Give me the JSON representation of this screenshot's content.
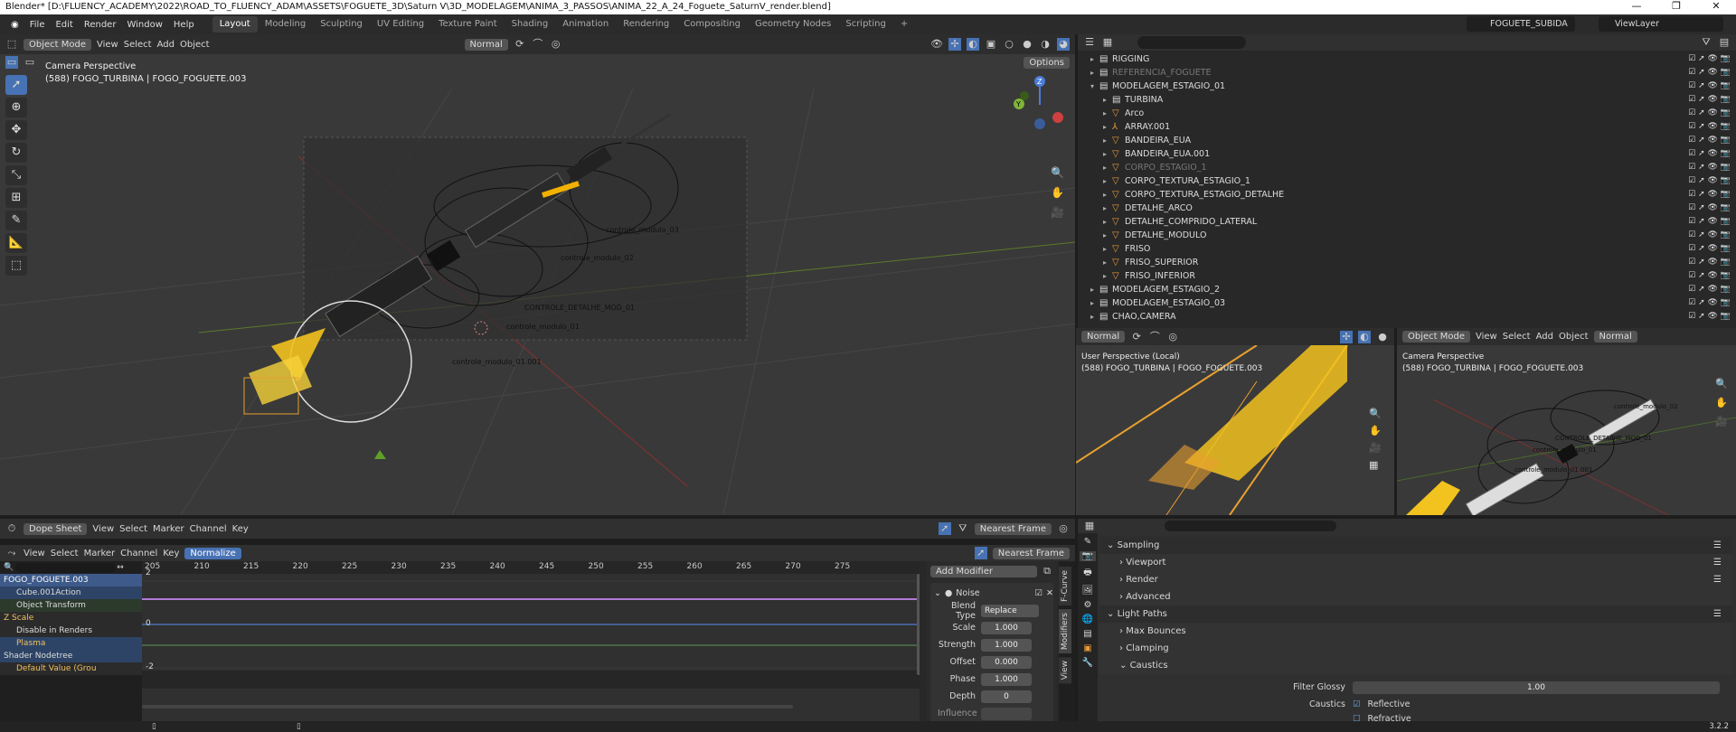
{
  "window": {
    "title": "Blender* [D:\\FLUENCY_ACADEMY\\2022\\ROAD_TO_FLUENCY_ADAM\\ASSETS\\FOGUETE_3D\\Saturn V\\3D_MODELAGEM\\ANIMA_3_PASSOS\\ANIMA_22_A_24_Foguete_SaturnV_render.blend]",
    "minimize": "—",
    "maximize": "❐",
    "close": "✕"
  },
  "menu": [
    "File",
    "Edit",
    "Render",
    "Window",
    "Help"
  ],
  "workspaces": [
    "Layout",
    "Modeling",
    "Sculpting",
    "UV Editing",
    "Texture Paint",
    "Shading",
    "Animation",
    "Rendering",
    "Compositing",
    "Geometry Nodes",
    "Scripting",
    "+"
  ],
  "scene": {
    "name": "FOGUETE_SUBIDA",
    "view_layer": "ViewLayer"
  },
  "viewport": {
    "mode": "Object Mode",
    "menus": [
      "View",
      "Select",
      "Add",
      "Object"
    ],
    "orientation": "Normal",
    "options": "Options",
    "label1": "Camera Perspective",
    "label2": "(588) FOGO_TURBINA | FOGO_FOGUETE.003",
    "scene_labels": [
      "controle_modulo_03",
      "controle_modulo_02",
      "CONTROLE_DETALHE_MOD_01",
      "controle_modulo_01",
      "controle_modulo_01.001"
    ]
  },
  "outliner": {
    "rows": [
      {
        "name": "RIGGING",
        "indent": 1,
        "icon": "▤",
        "color": "#ddd"
      },
      {
        "name": "REFERENCIA_FOGUETE",
        "indent": 1,
        "icon": "▤",
        "color": "#777"
      },
      {
        "name": "MODELAGEM_ESTAGIO_01",
        "indent": 1,
        "icon": "▤",
        "color": "#ddd",
        "open": true
      },
      {
        "name": "TURBINA",
        "indent": 2,
        "icon": "▤",
        "color": "#ddd"
      },
      {
        "name": "Arco",
        "indent": 2,
        "icon": "▽",
        "color": "#ddd"
      },
      {
        "name": "ARRAY.001",
        "indent": 2,
        "icon": "⅄",
        "color": "#ddd"
      },
      {
        "name": "BANDEIRA_EUA",
        "indent": 2,
        "icon": "▽",
        "color": "#ddd"
      },
      {
        "name": "BANDEIRA_EUA.001",
        "indent": 2,
        "icon": "▽",
        "color": "#ddd"
      },
      {
        "name": "CORPO_ESTAGIO_1",
        "indent": 2,
        "icon": "▽",
        "color": "#777"
      },
      {
        "name": "CORPO_TEXTURA_ESTAGIO_1",
        "indent": 2,
        "icon": "▽",
        "color": "#ddd"
      },
      {
        "name": "CORPO_TEXTURA_ESTAGIO_DETALHE",
        "indent": 2,
        "icon": "▽",
        "color": "#ddd"
      },
      {
        "name": "DETALHE_ARCO",
        "indent": 2,
        "icon": "▽",
        "color": "#ddd"
      },
      {
        "name": "DETALHE_COMPRIDO_LATERAL",
        "indent": 2,
        "icon": "▽",
        "color": "#ddd"
      },
      {
        "name": "DETALHE_MODULO",
        "indent": 2,
        "icon": "▽",
        "color": "#ddd"
      },
      {
        "name": "FRISO",
        "indent": 2,
        "icon": "▽",
        "color": "#ddd"
      },
      {
        "name": "FRISO_SUPERIOR",
        "indent": 2,
        "icon": "▽",
        "color": "#ddd"
      },
      {
        "name": "FRISO_INFERIOR",
        "indent": 2,
        "icon": "▽",
        "color": "#ddd"
      },
      {
        "name": "MODELAGEM_ESTAGIO_2",
        "indent": 1,
        "icon": "▤",
        "color": "#ddd"
      },
      {
        "name": "MODELAGEM_ESTAGIO_03",
        "indent": 1,
        "icon": "▤",
        "color": "#ddd"
      },
      {
        "name": "CHAO,CAMERA",
        "indent": 1,
        "icon": "▤",
        "color": "#ddd"
      }
    ]
  },
  "vp2": {
    "orientation": "Normal",
    "label1": "User Perspective (Local)",
    "label2": "(588) FOGO_TURBINA | FOGO_FOGUETE.003"
  },
  "vp3": {
    "mode": "Object Mode",
    "menus": [
      "View",
      "Select",
      "Add",
      "Object"
    ],
    "orientation": "Normal",
    "label1": "Camera Perspective",
    "label2": "(588) FOGO_TURBINA | FOGO_FOGUETE.003",
    "scene_labels": [
      "controle_modulo_02",
      "CONTROLE_DETALHE_MOD_01",
      "controle_modulo_01",
      "controle_modulo_01.001"
    ]
  },
  "dopesheet": {
    "editor": "Dope Sheet",
    "menus": [
      "View",
      "Select",
      "Marker",
      "Channel",
      "Key"
    ],
    "snap": "Nearest Frame"
  },
  "graph": {
    "menus": [
      "View",
      "Select",
      "Marker",
      "Channel",
      "Key"
    ],
    "normalize": "Normalize",
    "snap": "Nearest Frame",
    "frames": [
      "205",
      "210",
      "215",
      "220",
      "225",
      "230",
      "235",
      "240",
      "245",
      "250",
      "255",
      "260",
      "265",
      "270",
      "275"
    ],
    "yticks": [
      "2",
      "0",
      "-2"
    ],
    "channels": [
      {
        "name": "FOGO_FOGUETE.003",
        "bg": "#3d5a8a",
        "color": "#fff"
      },
      {
        "name": "Cube.001Action",
        "bg": "#2d4466",
        "color": "#ddd"
      },
      {
        "name": "Object Transform",
        "bg": "#2b3a2b",
        "color": "#ddd"
      },
      {
        "name": "Z Scale",
        "bg": "#2b2b2b",
        "color": "#f0c060"
      },
      {
        "name": "Disable in Renders",
        "bg": "#2b2b2b",
        "color": "#ddd"
      },
      {
        "name": "Plasma",
        "bg": "#2d4466",
        "color": "#f0c060"
      },
      {
        "name": "Shader Nodetree",
        "bg": "#2d4466",
        "color": "#ddd"
      },
      {
        "name": "Default Value (Grou",
        "bg": "#2b2b2b",
        "color": "#f0c060"
      }
    ]
  },
  "modifier": {
    "add": "Add Modifier",
    "name": "Noise",
    "blend_label": "Blend Type",
    "blend": "Replace",
    "props": [
      {
        "label": "Scale",
        "value": "1.000"
      },
      {
        "label": "Strength",
        "value": "1.000"
      },
      {
        "label": "Offset",
        "value": "0.000"
      },
      {
        "label": "Phase",
        "value": "1.000"
      },
      {
        "label": "Depth",
        "value": "0"
      }
    ],
    "influence": "Influence",
    "tabs": [
      "F-Curve",
      "Modifiers",
      "View"
    ]
  },
  "props": {
    "sections": [
      {
        "label": "Sampling",
        "open": true,
        "level": 0
      },
      {
        "label": "Viewport",
        "level": 1
      },
      {
        "label": "Render",
        "level": 1
      },
      {
        "label": "Advanced",
        "level": 1
      },
      {
        "label": "Light Paths",
        "open": true,
        "level": 0
      },
      {
        "label": "Max Bounces",
        "level": 1
      },
      {
        "label": "Clamping",
        "level": 1
      },
      {
        "label": "Caustics",
        "open": true,
        "level": 1
      }
    ],
    "filter_glossy_label": "Filter Glossy",
    "filter_glossy": "1.00",
    "caustics_label": "Caustics",
    "reflective": "Reflective",
    "refractive": "Refractive"
  },
  "status": {
    "version": "3.2.2"
  }
}
